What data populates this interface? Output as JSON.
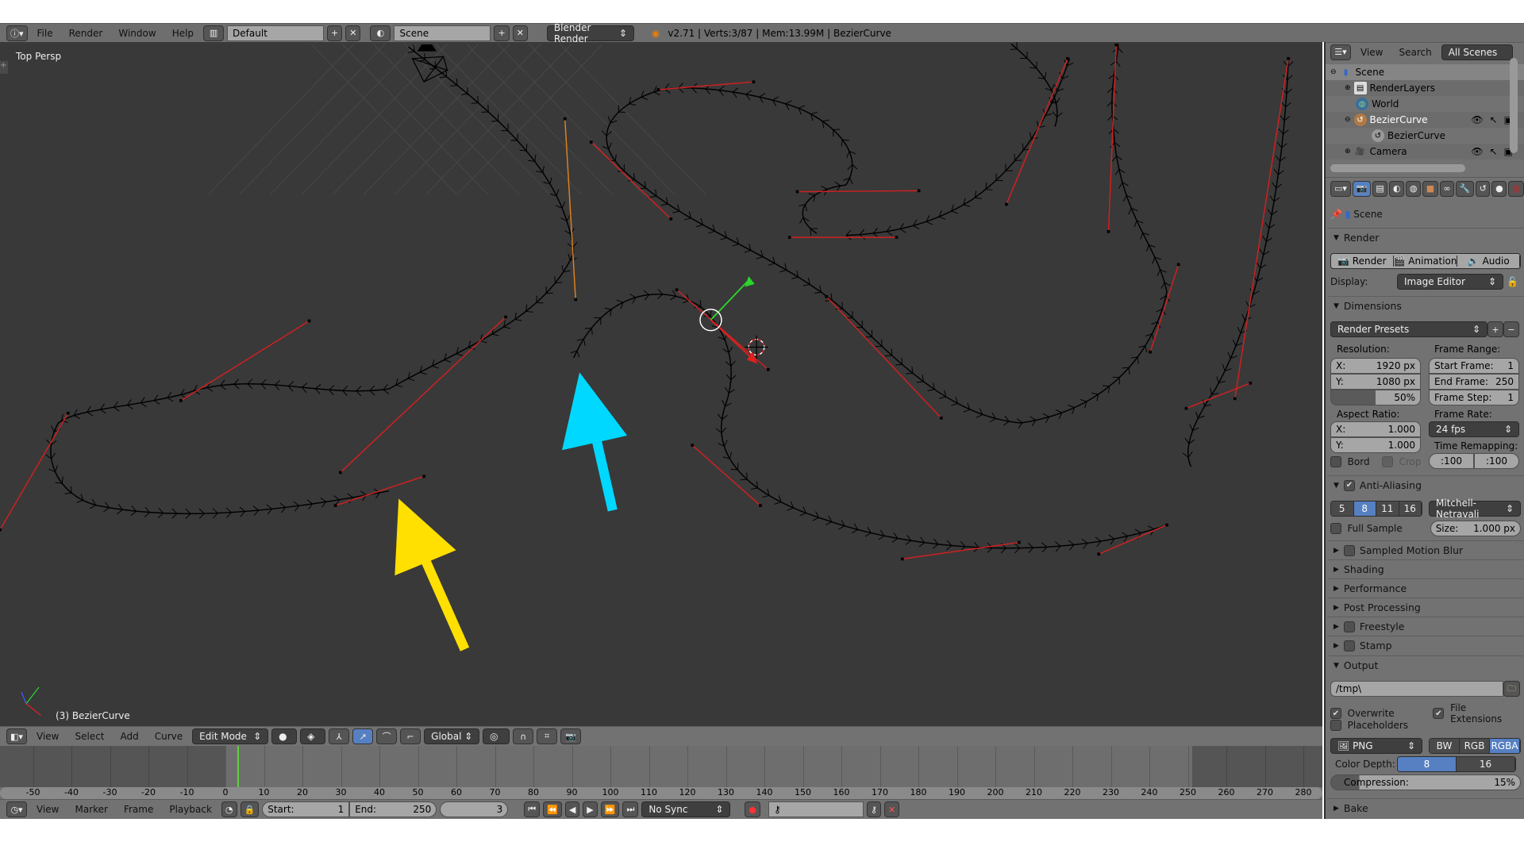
{
  "topbar": {
    "menus": [
      "File",
      "Render",
      "Window",
      "Help"
    ],
    "layout": "Default",
    "scene": "Scene",
    "engine": "Blender Render",
    "stats": "v2.71 | Verts:3/87 | Mem:13.99M | BezierCurve"
  },
  "viewport": {
    "view_label": "Top Persp",
    "object_label": "(3) BezierCurve",
    "arrow_colors": {
      "yellow": "#ffe000",
      "cyan": "#00d8ff"
    }
  },
  "view3d_header": {
    "menus": [
      "View",
      "Select",
      "Add",
      "Curve"
    ],
    "mode": "Edit Mode",
    "orientation": "Global"
  },
  "outliner": {
    "menus": [
      "View",
      "Search"
    ],
    "filter": "All Scenes",
    "items": [
      {
        "label": "Scene"
      },
      {
        "label": "RenderLayers"
      },
      {
        "label": "World"
      },
      {
        "label": "BezierCurve"
      },
      {
        "label": "BezierCurve"
      },
      {
        "label": "Camera"
      }
    ]
  },
  "properties": {
    "context": "Scene",
    "render": {
      "title": "Render",
      "render_btn": "Render",
      "animation_btn": "Animation",
      "audio_btn": "Audio",
      "display_label": "Display:",
      "display_value": "Image Editor"
    },
    "dimensions": {
      "title": "Dimensions",
      "presets": "Render Presets",
      "resolution_label": "Resolution:",
      "res_x_label": "X:",
      "res_x": "1920 px",
      "res_y_label": "Y:",
      "res_y": "1080 px",
      "res_pct": "50%",
      "frame_range_label": "Frame Range:",
      "start_label": "Start Frame:",
      "start": "1",
      "end_label": "End Frame:",
      "end": "250",
      "step_label": "Frame Step:",
      "step": "1",
      "aspect_label": "Aspect Ratio:",
      "asp_x_label": "X:",
      "asp_x": "1.000",
      "asp_y_label": "Y:",
      "asp_y": "1.000",
      "frame_rate_label": "Frame Rate:",
      "frame_rate": "24 fps",
      "time_remap_label": "Time Remapping:",
      "remap_old": ":100",
      "remap_new": ":100",
      "bord": "Bord",
      "crop": "Crop"
    },
    "aa": {
      "title": "Anti-Aliasing",
      "samples": [
        "5",
        "8",
        "11",
        "16"
      ],
      "selected_sample": "8",
      "filter": "Mitchell-Netravali",
      "full_sample": "Full Sample",
      "size_label": "Size:",
      "size": "1.000 px"
    },
    "collapsed": [
      "Sampled Motion Blur",
      "Shading",
      "Performance",
      "Post Processing",
      "Freestyle",
      "Stamp"
    ],
    "output": {
      "title": "Output",
      "path": "/tmp\\",
      "overwrite": "Overwrite",
      "file_extensions": "File Extensions",
      "placeholders": "Placeholders",
      "format": "PNG",
      "color_modes": [
        "BW",
        "RGB",
        "RGBA"
      ],
      "selected_color_mode": "RGBA",
      "color_depth_label": "Color Depth:",
      "depths": [
        "8",
        "16"
      ],
      "selected_depth": "8",
      "compression_label": "Compression:",
      "compression": "15%",
      "compression_value": 15
    },
    "bake": "Bake"
  },
  "timeline": {
    "ticks": [
      "-50",
      "-40",
      "-30",
      "-20",
      "-10",
      "0",
      "10",
      "20",
      "30",
      "40",
      "50",
      "60",
      "70",
      "80",
      "90",
      "100",
      "110",
      "120",
      "130",
      "140",
      "150",
      "160",
      "170",
      "180",
      "190",
      "200",
      "210",
      "220",
      "230",
      "240",
      "250",
      "260",
      "270",
      "280"
    ],
    "current_frame": 3,
    "menus": [
      "View",
      "Marker",
      "Frame",
      "Playback"
    ],
    "start_label": "Start:",
    "start": "1",
    "end_label": "End:",
    "end": "250",
    "frame": "3",
    "sync": "No Sync"
  }
}
